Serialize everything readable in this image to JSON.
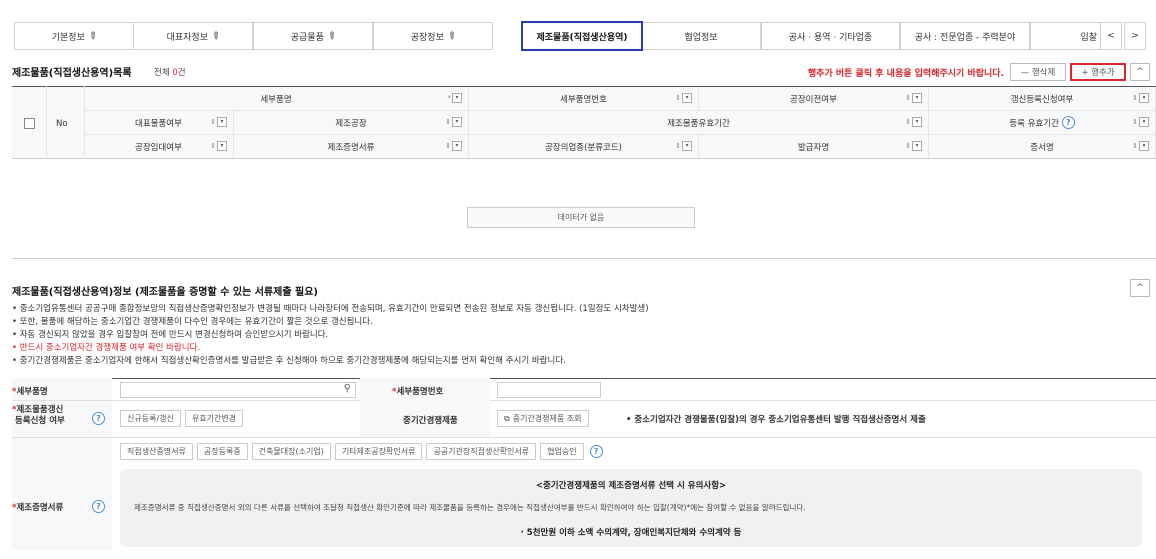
{
  "tabs": [
    {
      "label": "기본정보",
      "edit": true
    },
    {
      "label": "대표자정보",
      "edit": true
    },
    {
      "label": "공급물품",
      "edit": true
    },
    {
      "label": "공장정보",
      "edit": true
    },
    {
      "label": "제조물품(직접생산용역)",
      "edit": false
    },
    {
      "label": "협업정보",
      "edit": false
    },
    {
      "label": "공사 · 용역 · 기타업종",
      "edit": false
    },
    {
      "label": "공사 : 전문업종 - 주력분야",
      "edit": false
    },
    {
      "label": "입찰",
      "edit": false
    }
  ],
  "tab_nav": {
    "prev": "<",
    "next": ">"
  },
  "list": {
    "title": "제조물품(직접생산용역)목록",
    "total_prefix": "전체",
    "total_count": "0",
    "total_suffix": "건",
    "notice": "행추가 버튼 클릭 후 내용을 입력해주시기 바랍니다.",
    "delete_label": "— 행삭제",
    "add_label": "+ 행추가",
    "collapse": "^"
  },
  "table": {
    "no_label": "No",
    "row1": [
      "세부품명",
      "세부품명번호",
      "공장이전여부",
      "갱신등록신청여부"
    ],
    "row2": [
      "대표물품여부",
      "제조공장",
      "제조물품유효기간",
      "등록 유효기간"
    ],
    "row3": [
      "공장임대여부",
      "제조증명서류",
      "공장의업종(분류코드)",
      "발급자명",
      "증서명"
    ],
    "sort_symbol": "⇕",
    "sort_star": "*",
    "empty_label": "데이터가 없음"
  },
  "info": {
    "title": "제조물품(직접생산용역)정보 (제조물품을 증명할 수 있는 서류제출 필요)",
    "collapse": "^",
    "bullets": [
      {
        "text": "• 중소기업유통센터 공공구매 종합정보망의 직접생산증명확인정보가 변경될 때마다 나라장터에 전송되며, 유효기간이 만료되면 전송된 정보로 자동 갱신됩니다. (1일정도 시차발생)",
        "red": false
      },
      {
        "text": "• 또한, 물품에 해당하는 중소기업간 경쟁제품이 다수인 경우에는 유효기간이 짧은 것으로 갱신됩니다.",
        "red": false
      },
      {
        "text": "• 자동 갱신되지 않았을 경우 입찰참여 전에 반드시 변경신청하여 승인받으시기 바랍니다.",
        "red": false
      },
      {
        "text": "• 반드시 중소기업자간 경쟁제품 여부 확인 바랍니다.",
        "red": true
      },
      {
        "text": "• 중기간경쟁제품은 중소기업자에 한해서 직접생산확인증명서를 발급받은 후 신청해야 하므로 중기간경쟁제품에 해당되는지를 먼저 확인해 주시기 바랍니다.",
        "red": false
      }
    ]
  },
  "form": {
    "item_name_label": "세부품명",
    "item_no_label": "세부품명번호",
    "renew_label_1": "제조물품갱신",
    "renew_label_2": "등록신청 여부",
    "renew_options": [
      "신규등록/갱신",
      "유효기간변경"
    ],
    "competition_label": "중기간경쟁제품",
    "competition_btn": "중기간경쟁제품 조회",
    "competition_note": "• 중소기업자간 경쟁물품(입찰)의 경우 중소기업유통센터 발행 직접생산증명서 제출",
    "docs_label": "제조증명서류",
    "doc_options": [
      "직접생산증명서류",
      "공장등록증",
      "건축물대장(소기업)",
      "기타제조공장확인서류",
      "공공기관장직접생산확인서류",
      "협업승인"
    ],
    "panel_title": "<중기간경쟁제품의 제조증명서류 선택 시 유의사항>",
    "panel_line1": "제조증명서류 중 직접생산증명서 외의 다른 서류를 선택하여 조달청 직접생산 확인기준에 따라 제조물품을 등록하는 경우에는 직접생산여부를 반드시 확인하여야 하는 입찰(계약)*에는 참여할 수 없음을 알려드립니다.",
    "panel_line2": "· 5천만원 이하 소액 수의계약, 장애인복지단체와 수의계약 등"
  },
  "colors": {
    "accent_blue": "#2b3aad",
    "notice_red": "#d9262c",
    "help_blue": "#4a8fd8"
  }
}
